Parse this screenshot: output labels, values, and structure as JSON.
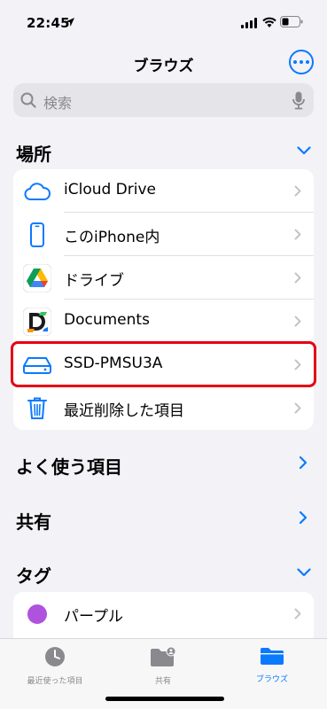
{
  "status_bar": {
    "time": "22:45"
  },
  "nav": {
    "title": "ブラウズ"
  },
  "search": {
    "placeholder": "検索"
  },
  "sections": {
    "locations": {
      "title": "場所"
    },
    "favorites": {
      "title": "よく使う項目"
    },
    "shared": {
      "title": "共有"
    },
    "tags": {
      "title": "タグ"
    }
  },
  "locations": [
    {
      "label": "iCloud Drive",
      "icon": "icloud-icon"
    },
    {
      "label": "このiPhone内",
      "icon": "iphone-icon"
    },
    {
      "label": "ドライブ",
      "icon": "google-drive-icon"
    },
    {
      "label": "Documents",
      "icon": "documents-app-icon"
    },
    {
      "label": "SSD-PMSU3A",
      "icon": "external-drive-icon"
    },
    {
      "label": "最近削除した項目",
      "icon": "trash-icon"
    }
  ],
  "tags": [
    {
      "label": "パープル",
      "color": "#af52de"
    }
  ],
  "tabs": [
    {
      "label": "最近使った項目",
      "icon": "clock-icon"
    },
    {
      "label": "共有",
      "icon": "shared-folder-icon"
    },
    {
      "label": "ブラウズ",
      "icon": "folder-icon"
    }
  ],
  "colors": {
    "accent": "#0a7aff",
    "highlight": "#e60012"
  }
}
